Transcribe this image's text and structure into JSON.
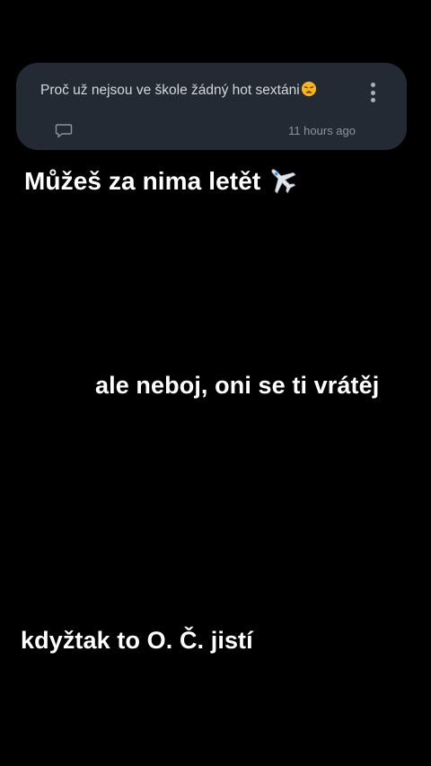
{
  "comment": {
    "text": "Proč už nejsou ve škole žádný hot sextáni",
    "emoji": "weary-face",
    "time": "11 hours ago",
    "menu_icon": "more-vertical-icon",
    "reply_icon": "comment-bubble-icon"
  },
  "captions": {
    "line1": "Můžeš za nima letět",
    "line1_emoji": "airplane",
    "line2": "ale neboj, oni se ti vrátěj",
    "line3": "kdyžtak to O. Č. jistí"
  },
  "colors": {
    "background": "#000000",
    "card": "#242a33",
    "card_text": "#d4d8de",
    "muted_text": "#8d939c",
    "caption_text": "#ffffff"
  }
}
